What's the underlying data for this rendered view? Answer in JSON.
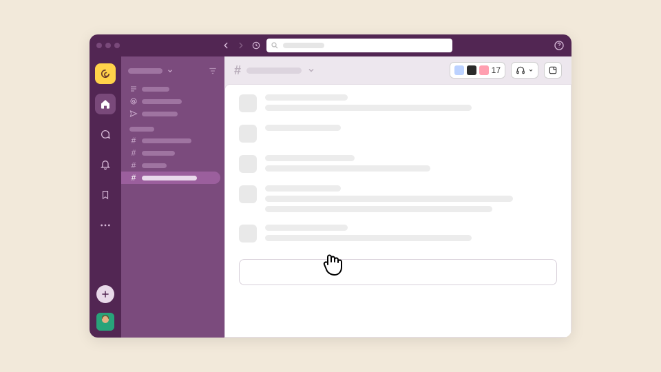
{
  "colors": {
    "bg": "#f2e9da",
    "topbar": "#522653",
    "rail": "#522653",
    "sidebar": "#7b4b7d",
    "selection": "#9b5f9d",
    "workspace_tile": "#ffd24a",
    "main_wash": "#ede7ee"
  },
  "topbar": {
    "traffic_lights": 3,
    "nav": {
      "back_enabled": true,
      "forward_enabled": false
    },
    "history_icon": "clock-icon",
    "search_placeholder": "",
    "help_icon": "help-icon"
  },
  "rail": {
    "workspace_icon": "swirl-icon",
    "items": [
      {
        "name": "home-icon",
        "active": true
      },
      {
        "name": "dm-icon",
        "active": false
      },
      {
        "name": "activity-icon",
        "active": false
      },
      {
        "name": "later-icon",
        "active": false
      },
      {
        "name": "more-icon",
        "active": false
      }
    ],
    "add_icon": "plus-icon",
    "user_avatar": "user-avatar"
  },
  "sidebar": {
    "workspace_name": "",
    "filter_icon": "filter-icon",
    "quick": [
      {
        "icon": "thread-icon",
        "label_w": 40
      },
      {
        "icon": "mentions-icon",
        "label_w": 58
      },
      {
        "icon": "drafts-icon",
        "label_w": 52
      }
    ],
    "channels_header": "",
    "channels": [
      {
        "label_w": 72,
        "selected": false
      },
      {
        "label_w": 48,
        "selected": false
      },
      {
        "label_w": 36,
        "selected": false
      },
      {
        "label_w": 80,
        "selected": true
      }
    ]
  },
  "channel_header": {
    "hash": "#",
    "name": "",
    "member_count": "17",
    "member_avatars": 3,
    "huddle_icon": "headphones-icon",
    "canvas_icon": "canvas-icon"
  },
  "messages": [
    {
      "lines": [
        120,
        300
      ]
    },
    {
      "lines": [
        110
      ]
    },
    {
      "lines": [
        130,
        240
      ]
    },
    {
      "lines": [
        110,
        360,
        330
      ]
    },
    {
      "lines": [
        120,
        300
      ]
    }
  ],
  "composer": {
    "placeholder": ""
  },
  "cursor": {
    "type": "pointer-hand"
  }
}
